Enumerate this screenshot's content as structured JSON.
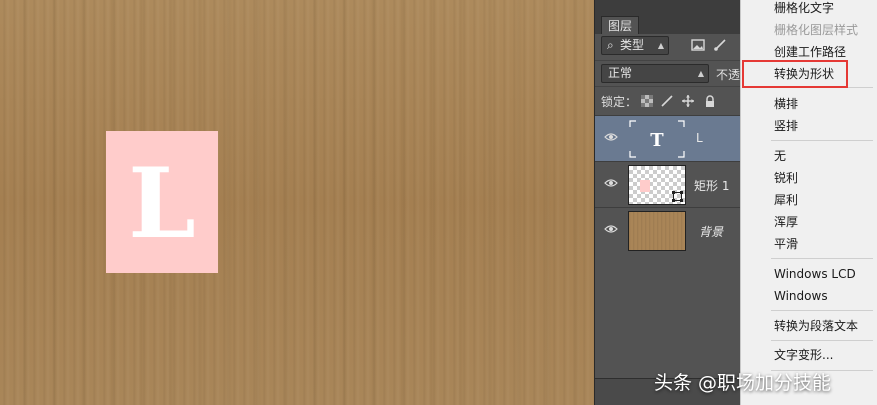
{
  "canvas": {
    "letter": "L",
    "colors": {
      "cardboard": "#a98557",
      "pink_rect": "#ffcccb",
      "letter": "#ffffff"
    }
  },
  "layers_panel": {
    "tab_label": "图层",
    "filter": {
      "icon": "search-icon",
      "label": "类型"
    },
    "blend_mode": "正常",
    "opacity_label": "不透",
    "lock_label": "锁定：",
    "layers": [
      {
        "name": "L",
        "type": "text",
        "thumb_glyph": "T",
        "selected": true
      },
      {
        "name": "矩形 1",
        "type": "shape",
        "selected": false
      },
      {
        "name": "背景",
        "type": "background",
        "selected": false
      }
    ],
    "colors": {
      "panel_bg": "#535353",
      "selected_bg": "#6a7a91"
    }
  },
  "context_menu": {
    "items": [
      {
        "label": "栅格化文字",
        "enabled": true
      },
      {
        "label": "栅格化图层样式",
        "enabled": false
      },
      {
        "label": "创建工作路径",
        "enabled": true
      },
      {
        "label": "转换为形状",
        "enabled": true,
        "highlighted": true
      },
      {
        "label": "横排",
        "enabled": true
      },
      {
        "label": "竖排",
        "enabled": true
      },
      {
        "label": "无",
        "enabled": true
      },
      {
        "label": "锐利",
        "enabled": true
      },
      {
        "label": "犀利",
        "enabled": true
      },
      {
        "label": "浑厚",
        "enabled": true
      },
      {
        "label": "平滑",
        "enabled": true
      },
      {
        "label": "Windows LCD",
        "enabled": true
      },
      {
        "label": "Windows",
        "enabled": true
      },
      {
        "label": "转换为段落文本",
        "enabled": true
      },
      {
        "label": "文字变形...",
        "enabled": true
      }
    ],
    "highlight_color": "#e53935"
  },
  "watermark": "头条 @职场加分技能"
}
